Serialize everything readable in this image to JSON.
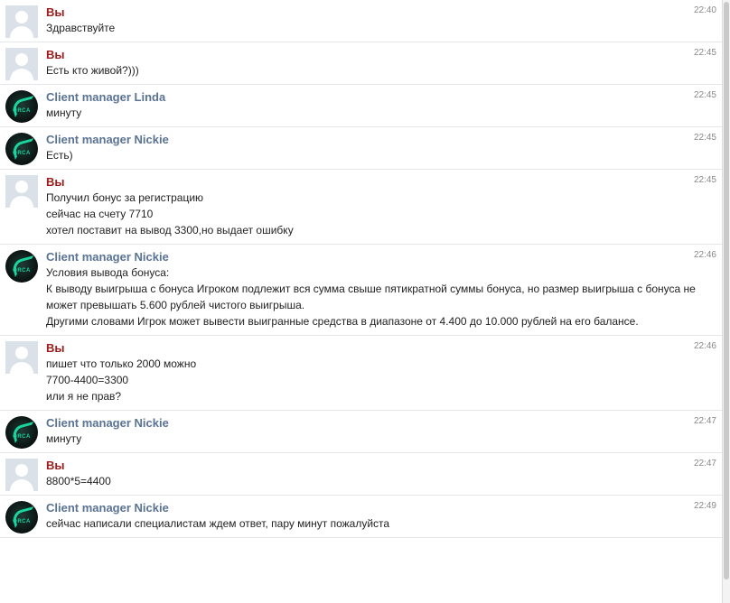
{
  "messages": [
    {
      "sender": "Вы",
      "type": "you",
      "time": "22:40",
      "lines": [
        "Здравствуйте"
      ]
    },
    {
      "sender": "Вы",
      "type": "you",
      "time": "22:45",
      "lines": [
        "Есть кто живой?)))"
      ]
    },
    {
      "sender": "Client manager Linda",
      "type": "manager",
      "time": "22:45",
      "lines": [
        "минуту"
      ]
    },
    {
      "sender": "Client manager Nickie",
      "type": "manager",
      "time": "22:45",
      "lines": [
        "Есть)"
      ]
    },
    {
      "sender": "Вы",
      "type": "you",
      "time": "22:45",
      "lines": [
        "Получил бонус за регистрацию",
        "сейчас на счету 7710",
        "хотел поставит на вывод 3300,но выдает ошибку"
      ]
    },
    {
      "sender": "Client manager Nickie",
      "type": "manager",
      "time": "22:46",
      "lines": [
        "Условия вывода бонуса:",
        "К выводу выигрыша с бонуса Игроком подлежит вся сумма свыше пятикратной суммы бонуса, но размер выигрыша с бонуса не может превышать 5.600 рублей чистого выигрыша.",
        "Другими словами Игрок может вывести выигранные средства в диапазоне от 4.400 до 10.000 рублей на его балансе."
      ]
    },
    {
      "sender": "Вы",
      "type": "you",
      "time": "22:46",
      "lines": [
        "пишет что только 2000 можно",
        "7700-4400=3300",
        "или я не прав?"
      ]
    },
    {
      "sender": "Client manager Nickie",
      "type": "manager",
      "time": "22:47",
      "lines": [
        "минуту"
      ]
    },
    {
      "sender": "Вы",
      "type": "you",
      "time": "22:47",
      "lines": [
        "8800*5=4400"
      ]
    },
    {
      "sender": "Client manager Nickie",
      "type": "manager",
      "time": "22:49",
      "lines": [
        "сейчас написали специалистам ждем ответ, пару минут пожалуйста"
      ]
    }
  ],
  "icons": {
    "user_avatar": "user-silhouette-icon",
    "manager_avatar": "brand-logo-icon"
  },
  "manager_logo_text": "ORCA",
  "colors": {
    "you_name": "#9c1b1b",
    "manager_name": "#5a7394",
    "time": "#888888",
    "divider": "#e4e6ea"
  }
}
